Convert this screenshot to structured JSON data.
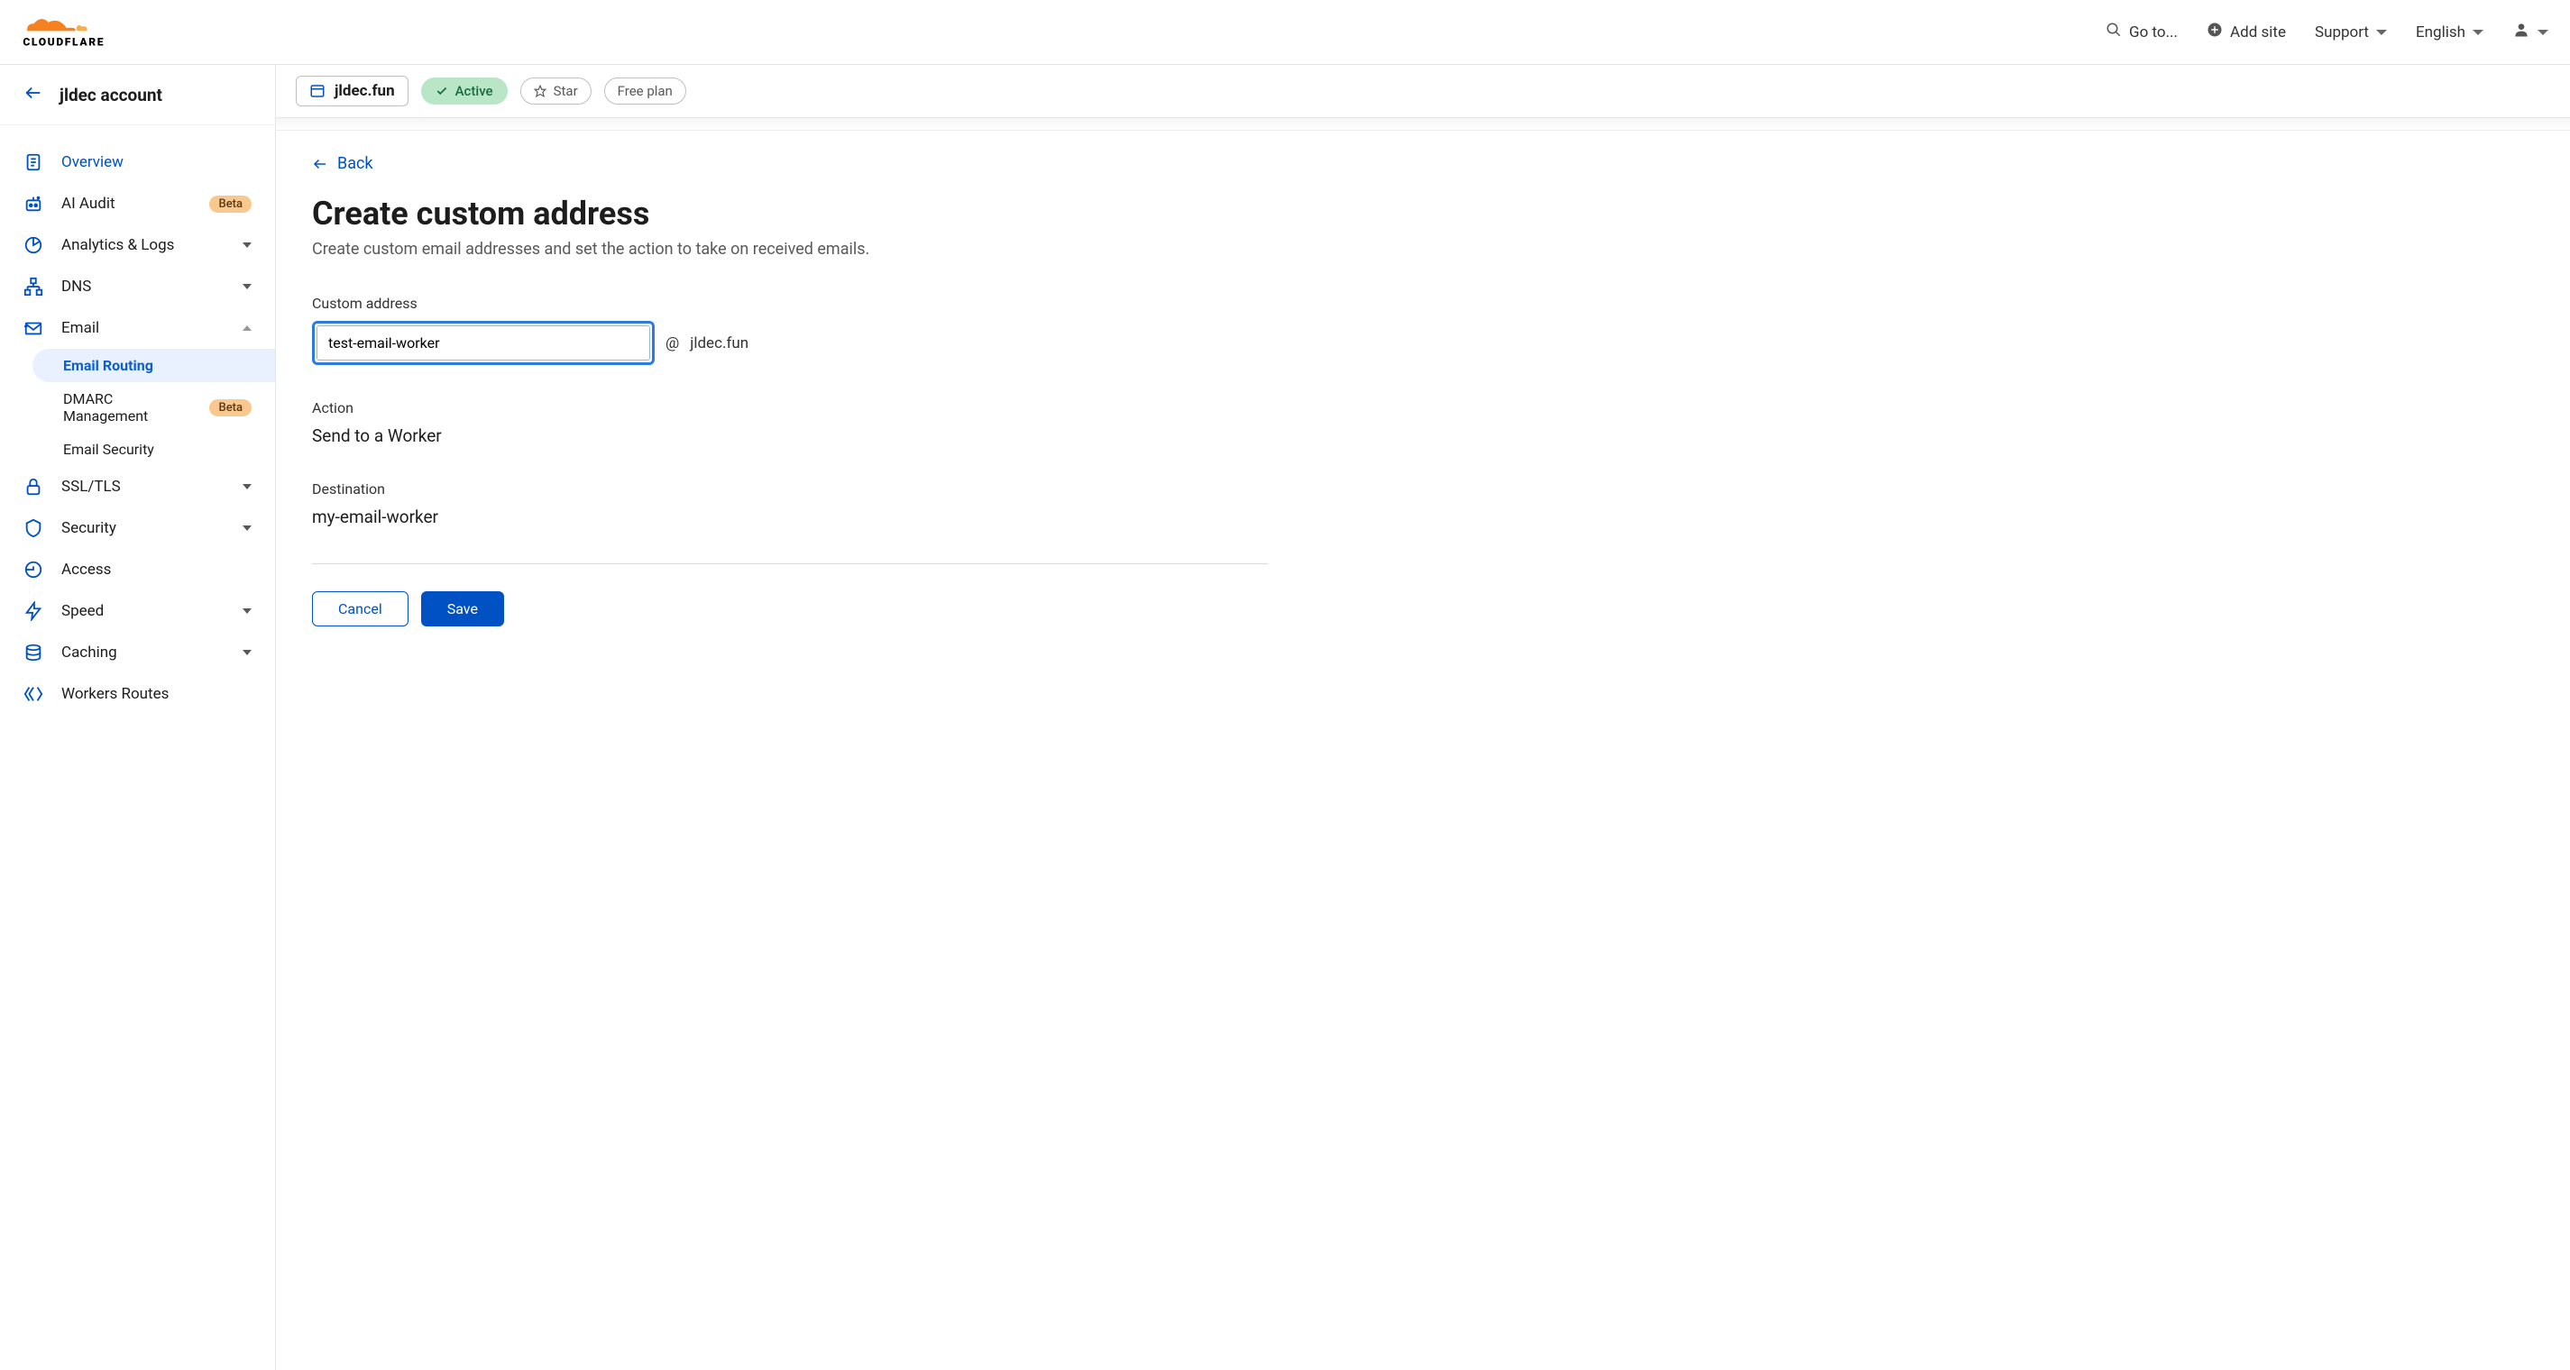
{
  "header": {
    "goto": "Go to...",
    "add_site": "Add site",
    "support": "Support",
    "language": "English"
  },
  "sidebar": {
    "account_name": "jldec account",
    "items": {
      "overview": "Overview",
      "ai_audit": "AI Audit",
      "ai_audit_badge": "Beta",
      "analytics": "Analytics & Logs",
      "dns": "DNS",
      "email": "Email",
      "email_routing": "Email Routing",
      "dmarc": "DMARC Management",
      "dmarc_badge": "Beta",
      "email_security": "Email Security",
      "ssl": "SSL/TLS",
      "security": "Security",
      "access": "Access",
      "speed": "Speed",
      "caching": "Caching",
      "workers_routes": "Workers Routes"
    }
  },
  "domain_bar": {
    "domain": "jldec.fun",
    "status": "Active",
    "star": "Star",
    "plan": "Free plan"
  },
  "page": {
    "back": "Back",
    "title": "Create custom address",
    "description": "Create custom email addresses and set the action to take on received emails.",
    "custom_address_label": "Custom address",
    "custom_address_value": "test-email-worker",
    "at": "@",
    "domain_suffix": "jldec.fun",
    "action_label": "Action",
    "action_value": "Send to a Worker",
    "destination_label": "Destination",
    "destination_value": "my-email-worker",
    "cancel": "Cancel",
    "save": "Save"
  }
}
